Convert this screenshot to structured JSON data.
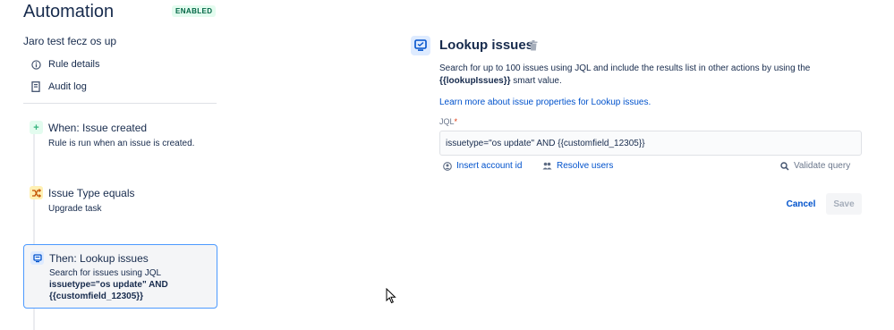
{
  "header": {
    "title": "Automation",
    "status": "ENABLED"
  },
  "sidebar": {
    "rule_name": "Jaro test fecz os up",
    "links": [
      {
        "label": "Rule details",
        "icon": "info-icon"
      },
      {
        "label": "Audit log",
        "icon": "document-icon"
      }
    ]
  },
  "flow": {
    "trigger": {
      "title": "When: Issue created",
      "desc": "Rule is run when an issue is created.",
      "icon": "plus-icon"
    },
    "condition": {
      "title": "Issue Type equals",
      "desc": "Upgrade task",
      "icon": "shuffle-icon"
    },
    "action": {
      "title": "Then: Lookup issues",
      "desc": "Search for issues using JQL",
      "query_line1": "issuetype=\"os update\" AND",
      "query_line2": "{{customfield_12305}}",
      "icon": "monitor-icon"
    }
  },
  "panel": {
    "title": "Lookup issues",
    "desc_part1": "Search for up to 100 issues using JQL and include the results list in other actions by using the",
    "desc_smart": "{{lookupIssues}}",
    "desc_part2": " smart value.",
    "learn_link": "Learn more about issue properties for Lookup issues.",
    "jql_label": "JQL",
    "jql_required": "*",
    "jql_value": "issuetype=\"os update\" AND {{customfield_12305}}",
    "insert_account": "Insert account id",
    "resolve_users": "Resolve users",
    "validate_query": "Validate query",
    "cancel": "Cancel",
    "save": "Save"
  },
  "colors": {
    "accent": "#0052cc",
    "badge_bg": "#e3fcef",
    "badge_text": "#006644",
    "selected_border": "#4c9aff"
  }
}
